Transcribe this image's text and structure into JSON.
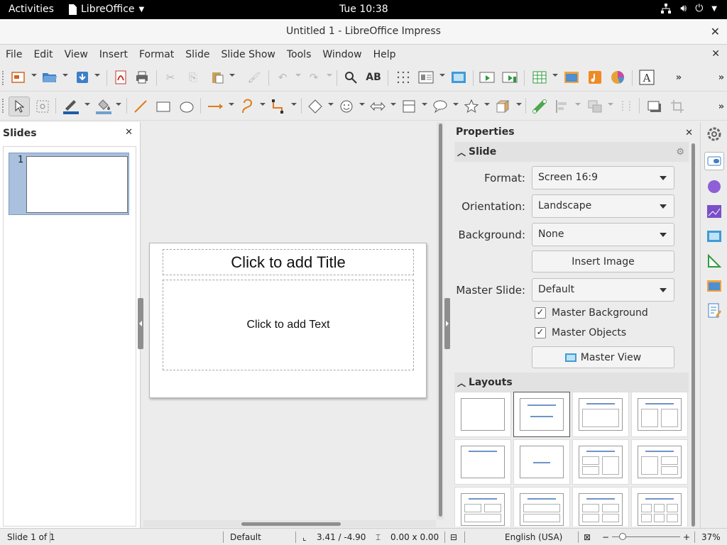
{
  "topbar": {
    "activities": "Activities",
    "app_name": "LibreOffice",
    "clock": "Tue 10:38"
  },
  "window": {
    "title": "Untitled 1 - LibreOffice Impress"
  },
  "menu": [
    "File",
    "Edit",
    "View",
    "Insert",
    "Format",
    "Slide",
    "Slide Show",
    "Tools",
    "Window",
    "Help"
  ],
  "slides_pane": {
    "title": "Slides",
    "slide_number": "1"
  },
  "slide": {
    "title_placeholder": "Click to add Title",
    "text_placeholder": "Click to add Text"
  },
  "properties": {
    "title": "Properties",
    "slide_section": "Slide",
    "format_label": "Format:",
    "format_value": "Screen 16:9",
    "orientation_label": "Orientation:",
    "orientation_value": "Landscape",
    "background_label": "Background:",
    "background_value": "None",
    "insert_image": "Insert Image",
    "master_slide_label": "Master Slide:",
    "master_slide_value": "Default",
    "master_background": "Master Background",
    "master_background_checked": true,
    "master_objects": "Master Objects",
    "master_objects_checked": true,
    "master_view": "Master View",
    "layouts_section": "Layouts"
  },
  "statusbar": {
    "slide_info": "Slide 1 of 1",
    "master": "Default",
    "position": "3.41 / -4.90",
    "size": "0.00 x 0.00",
    "language": "English (USA)",
    "zoom": "37%"
  },
  "colors": {
    "accent": "#6f95c7",
    "selection": "#a9c0de"
  }
}
